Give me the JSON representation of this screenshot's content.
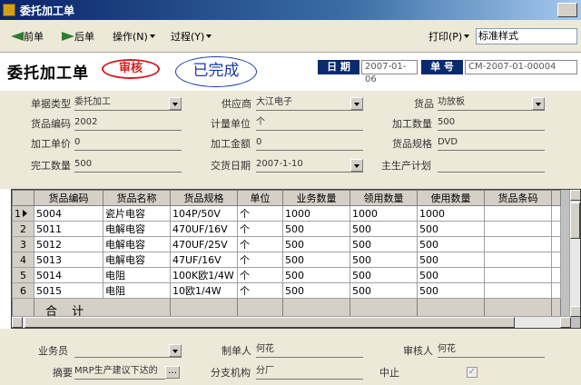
{
  "window": {
    "title": "委托加工单"
  },
  "toolbar": {
    "prev_label": "前单",
    "next_label": "后单",
    "operate_label": "操作(N)",
    "process_label": "过程(Y)",
    "print_label": "打印(P)",
    "print_style_value": "标准样式"
  },
  "header": {
    "doc_title": "委托加工单",
    "audit_stamp": "审核",
    "status_stamp": "已完成",
    "date_label": "日 期",
    "date_value": "2007-01-06",
    "number_label": "单 号",
    "number_value": "CM-2007-01-00004"
  },
  "form": {
    "doc_type_label": "单据类型",
    "doc_type_value": "委托加工",
    "supplier_label": "供应商",
    "supplier_value": "大江电子",
    "goods_label": "货品",
    "goods_value": "功放板",
    "goods_code_label": "货品编码",
    "goods_code_value": "2002",
    "unit_label": "计量单位",
    "unit_value": "个",
    "qty_label": "加工数量",
    "qty_value": "500",
    "price_label": "加工单价",
    "price_value": "0",
    "amount_label": "加工金额",
    "amount_value": "0",
    "spec_label": "货品规格",
    "spec_value": "DVD",
    "done_qty_label": "完工数量",
    "done_qty_value": "500",
    "delivery_label": "交货日期",
    "delivery_value": "2007-1-10",
    "plan_label": "主生产计划",
    "plan_value": ""
  },
  "grid": {
    "columns": [
      "货品编码",
      "货品名称",
      "货品规格",
      "单位",
      "业务数量",
      "领用数量",
      "使用数量",
      "货品条码"
    ],
    "rows": [
      [
        "5004",
        "瓷片电容",
        "104P/50V",
        "个",
        "1000",
        "1000",
        "1000",
        ""
      ],
      [
        "5011",
        "电解电容",
        "470UF/16V",
        "个",
        "500",
        "500",
        "500",
        ""
      ],
      [
        "5012",
        "电解电容",
        "470UF/25V",
        "个",
        "500",
        "500",
        "500",
        ""
      ],
      [
        "5013",
        "电解电容",
        "47UF/16V",
        "个",
        "500",
        "500",
        "500",
        ""
      ],
      [
        "5014",
        "电阻",
        "100K欧1/4W",
        "个",
        "500",
        "500",
        "500",
        ""
      ],
      [
        "5015",
        "电阻",
        "10欧1/4W",
        "个",
        "500",
        "500",
        "500",
        ""
      ]
    ],
    "row_numbers": [
      "1",
      "2",
      "3",
      "4",
      "5",
      "6"
    ],
    "total_label": "合 计"
  },
  "footer": {
    "salesman_label": "业务员",
    "salesman_value": "",
    "maker_label": "制单人",
    "maker_value": "何花",
    "auditor_label": "审核人",
    "auditor_value": "何花",
    "summary_label": "摘要",
    "summary_value": "MRP生产建议下达的",
    "branch_label": "分支机构",
    "branch_value": "分厂",
    "stop_label": "中止"
  }
}
